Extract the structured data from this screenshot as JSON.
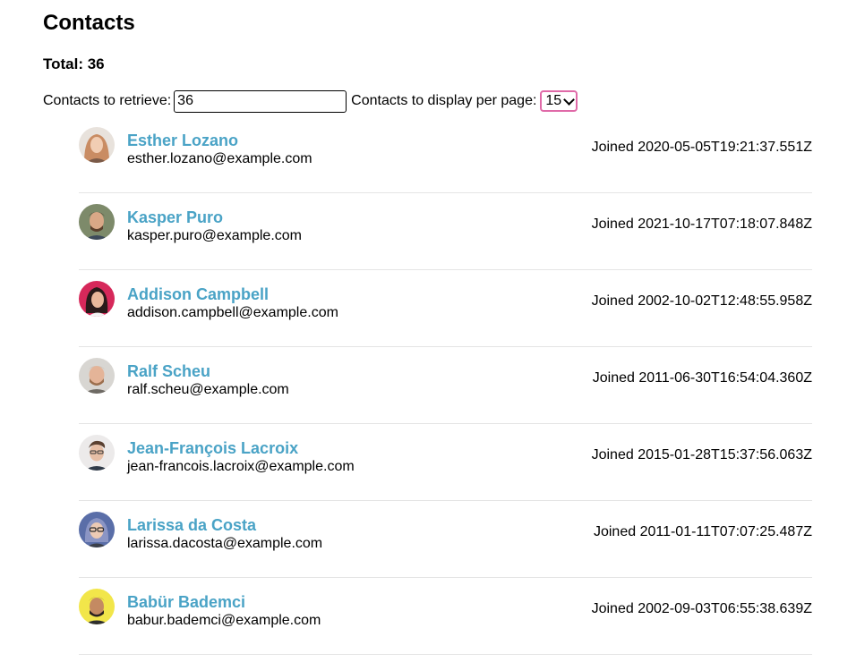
{
  "page": {
    "title": "Contacts",
    "total_label": "Total: 36"
  },
  "controls": {
    "retrieve_label": "Contacts to retrieve:",
    "retrieve_value": "36",
    "per_page_label": "Contacts to display per page:",
    "per_page_value": "15"
  },
  "colors": {
    "name_link": "#4aa3c6",
    "select_focus_border": "#e06aa8",
    "divider": "#e4e4e4"
  },
  "contacts": [
    {
      "name": "Esther Lozano",
      "email": "esther.lozano@example.com",
      "joined": "Joined 2020-05-05T19:21:37.551Z",
      "avatar": "avatar-photo-icon"
    },
    {
      "name": "Kasper Puro",
      "email": "kasper.puro@example.com",
      "joined": "Joined 2021-10-17T07:18:07.848Z",
      "avatar": "avatar-photo-icon"
    },
    {
      "name": "Addison Campbell",
      "email": "addison.campbell@example.com",
      "joined": "Joined 2002-10-02T12:48:55.958Z",
      "avatar": "avatar-photo-icon"
    },
    {
      "name": "Ralf Scheu",
      "email": "ralf.scheu@example.com",
      "joined": "Joined 2011-06-30T16:54:04.360Z",
      "avatar": "avatar-photo-icon"
    },
    {
      "name": "Jean-François Lacroix",
      "email": "jean-francois.lacroix@example.com",
      "joined": "Joined 2015-01-28T15:37:56.063Z",
      "avatar": "avatar-photo-icon"
    },
    {
      "name": "Larissa da Costa",
      "email": "larissa.dacosta@example.com",
      "joined": "Joined 2011-01-11T07:07:25.487Z",
      "avatar": "avatar-photo-icon"
    },
    {
      "name": "Babür Bademci",
      "email": "babur.bademci@example.com",
      "joined": "Joined 2002-09-03T06:55:38.639Z",
      "avatar": "avatar-photo-icon"
    }
  ]
}
